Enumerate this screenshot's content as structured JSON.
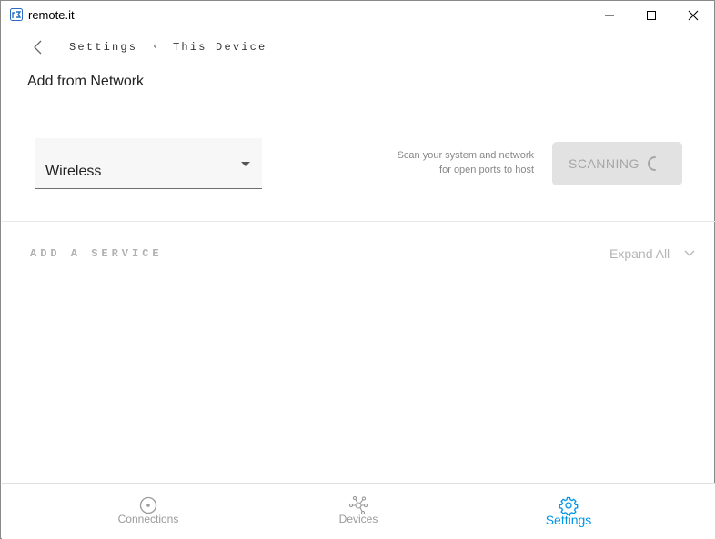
{
  "window": {
    "title": "remote.it",
    "icon": "remoteit-logo-icon"
  },
  "header": {
    "breadcrumb": [
      "Settings",
      "This Device"
    ],
    "page_title": "Add from Network"
  },
  "scan": {
    "interface_value": "Wireless",
    "help_line1": "Scan your system and network",
    "help_line2": "for open ports to host",
    "button_label": "SCANNING",
    "state": "scanning"
  },
  "services": {
    "section_title": "ADD A SERVICE",
    "expand_label": "Expand All"
  },
  "nav": {
    "items": [
      {
        "label": "Connections",
        "icon": "connections-icon",
        "active": false
      },
      {
        "label": "Devices",
        "icon": "devices-icon",
        "active": false
      },
      {
        "label": "Settings",
        "icon": "gear-icon",
        "active": true
      }
    ]
  },
  "colors": {
    "accent": "#0096e7",
    "inactive": "#9a9a9a",
    "disabled_button": "#e2e2e2"
  }
}
